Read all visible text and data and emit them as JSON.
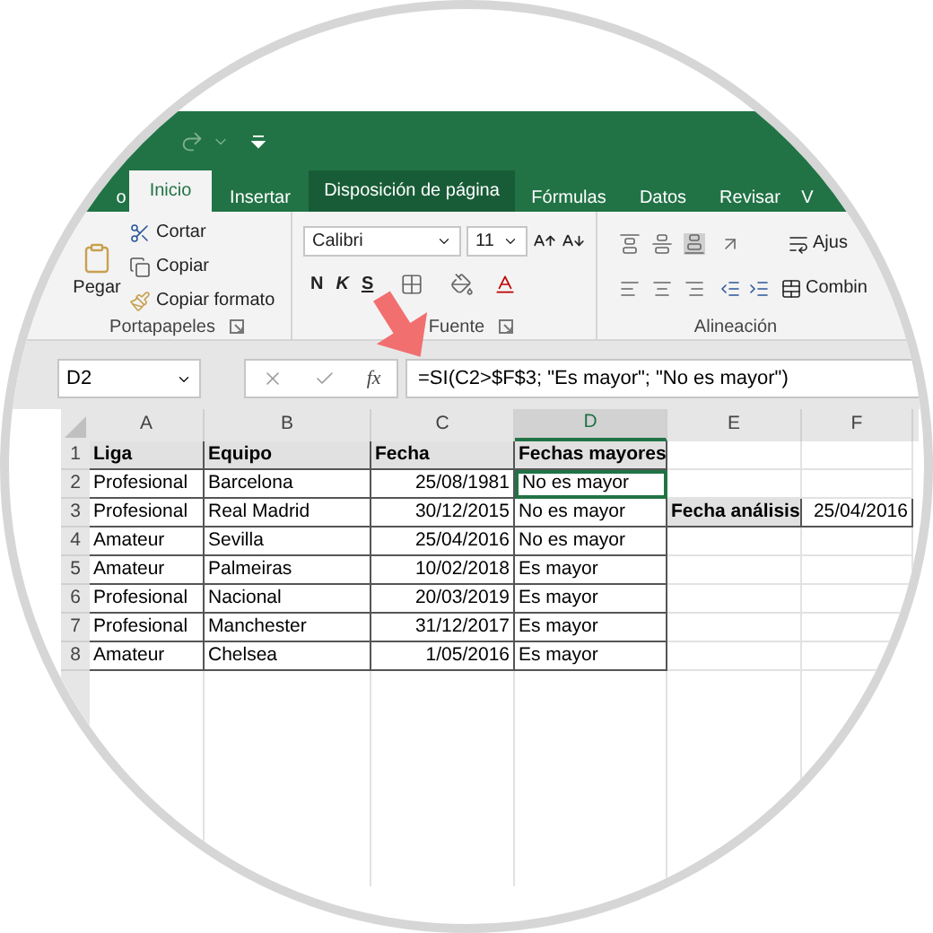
{
  "tabs": [
    {
      "label": "o",
      "selected": false,
      "highlighted": false
    },
    {
      "label": "Inicio",
      "selected": true,
      "highlighted": false
    },
    {
      "label": "Insertar",
      "selected": false,
      "highlighted": false
    },
    {
      "label": "Disposición de página",
      "selected": false,
      "highlighted": true
    },
    {
      "label": "Fórmulas",
      "selected": false,
      "highlighted": false
    },
    {
      "label": "Datos",
      "selected": false,
      "highlighted": false
    },
    {
      "label": "Revisar",
      "selected": false,
      "highlighted": false
    },
    {
      "label": "V",
      "selected": false,
      "highlighted": false
    }
  ],
  "clipboard": {
    "paste": "Pegar",
    "cut": "Cortar",
    "copy": "Copiar",
    "format_painter": "Copiar formato",
    "label": "Portapapeles"
  },
  "font": {
    "name": "Calibri",
    "size": "11",
    "bold": "N",
    "italic": "K",
    "underline": "S",
    "label": "Fuente"
  },
  "alignment": {
    "wrap": "Ajus",
    "merge": "Combin",
    "label": "Alineación"
  },
  "formula_bar": {
    "name_box": "D2",
    "fx": "fx",
    "formula": "=SI(C2>$F$3; \"Es mayor\"; \"No es mayor\")"
  },
  "table": {
    "columns": [
      {
        "label": "A",
        "selected": false
      },
      {
        "label": "B",
        "selected": false
      },
      {
        "label": "C",
        "selected": false
      },
      {
        "label": "D",
        "selected": true
      },
      {
        "label": "E",
        "selected": false
      },
      {
        "label": "F",
        "selected": false
      }
    ],
    "rows": [
      {
        "number": "1",
        "cells": [
          {
            "kind": "header",
            "text": "Liga",
            "selected": false
          },
          {
            "kind": "header",
            "text": "Equipo",
            "selected": false
          },
          {
            "kind": "header",
            "text": "Fecha",
            "selected": false
          },
          {
            "kind": "header",
            "text": "Fechas mayores",
            "selected": false
          },
          {
            "kind": "empty",
            "selected": false
          },
          {
            "kind": "empty",
            "selected": false
          }
        ]
      },
      {
        "number": "2",
        "cells": [
          {
            "kind": "text",
            "text": "Profesional",
            "selected": false
          },
          {
            "kind": "text",
            "text": "Barcelona",
            "selected": false
          },
          {
            "kind": "number",
            "text": "25/08/1981",
            "selected": false
          },
          {
            "kind": "text",
            "text": "No es mayor",
            "selected": true
          },
          {
            "kind": "empty",
            "selected": false
          },
          {
            "kind": "empty",
            "selected": false
          }
        ]
      },
      {
        "number": "3",
        "cells": [
          {
            "kind": "text",
            "text": "Profesional",
            "selected": false
          },
          {
            "kind": "text",
            "text": "Real Madrid",
            "selected": false
          },
          {
            "kind": "number",
            "text": "30/12/2015",
            "selected": false
          },
          {
            "kind": "text",
            "text": "No es mayor",
            "selected": false
          },
          {
            "kind": "header",
            "text": "Fecha análisis",
            "selected": false
          },
          {
            "kind": "number",
            "text": "25/04/2016",
            "selected": false
          }
        ]
      },
      {
        "number": "4",
        "cells": [
          {
            "kind": "text",
            "text": "Amateur",
            "selected": false
          },
          {
            "kind": "text",
            "text": "Sevilla",
            "selected": false
          },
          {
            "kind": "number",
            "text": "25/04/2016",
            "selected": false
          },
          {
            "kind": "text",
            "text": "No es mayor",
            "selected": false
          },
          {
            "kind": "empty",
            "selected": false
          },
          {
            "kind": "empty",
            "selected": false
          }
        ]
      },
      {
        "number": "5",
        "cells": [
          {
            "kind": "text",
            "text": "Amateur",
            "selected": false
          },
          {
            "kind": "text",
            "text": "Palmeiras",
            "selected": false
          },
          {
            "kind": "number",
            "text": "10/02/2018",
            "selected": false
          },
          {
            "kind": "text",
            "text": "Es mayor",
            "selected": false
          },
          {
            "kind": "empty",
            "selected": false
          },
          {
            "kind": "empty",
            "selected": false
          }
        ]
      },
      {
        "number": "6",
        "cells": [
          {
            "kind": "text",
            "text": "Profesional",
            "selected": false
          },
          {
            "kind": "text",
            "text": "Nacional",
            "selected": false
          },
          {
            "kind": "number",
            "text": "20/03/2019",
            "selected": false
          },
          {
            "kind": "text",
            "text": "Es mayor",
            "selected": false
          },
          {
            "kind": "empty",
            "selected": false
          },
          {
            "kind": "empty",
            "selected": false
          }
        ]
      },
      {
        "number": "7",
        "cells": [
          {
            "kind": "text",
            "text": "Profesional",
            "selected": false
          },
          {
            "kind": "text",
            "text": "Manchester",
            "selected": false
          },
          {
            "kind": "number",
            "text": "31/12/2017",
            "selected": false
          },
          {
            "kind": "text",
            "text": "Es mayor",
            "selected": false
          },
          {
            "kind": "empty",
            "selected": false
          },
          {
            "kind": "empty",
            "selected": false
          }
        ]
      },
      {
        "number": "8",
        "cells": [
          {
            "kind": "text",
            "text": "Amateur",
            "selected": false
          },
          {
            "kind": "text",
            "text": "Chelsea",
            "selected": false
          },
          {
            "kind": "number",
            "text": "1/05/2016",
            "selected": false
          },
          {
            "kind": "text",
            "text": "Es mayor",
            "selected": false
          },
          {
            "kind": "empty",
            "selected": false
          },
          {
            "kind": "empty",
            "selected": false
          }
        ]
      }
    ]
  }
}
